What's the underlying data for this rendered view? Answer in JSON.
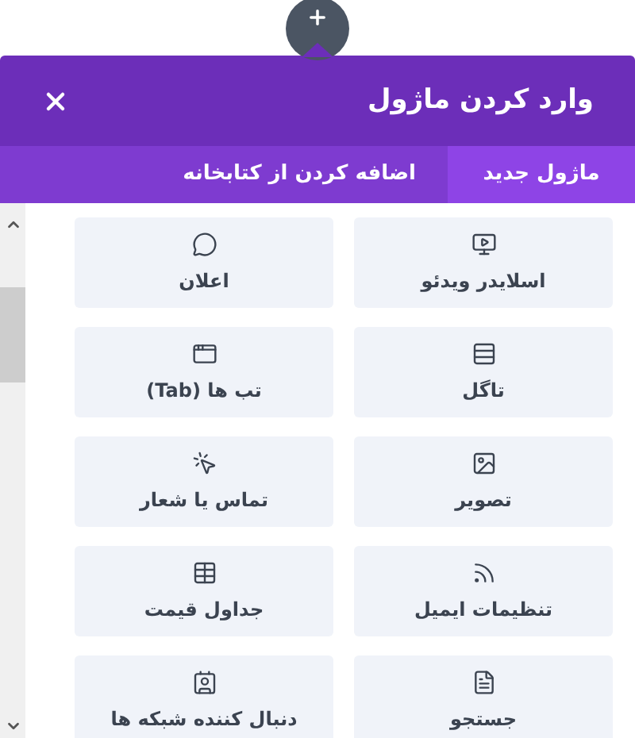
{
  "dialog": {
    "title": "وارد کردن ماژول"
  },
  "tabs": [
    {
      "label": "ماژول جدید",
      "selected": true
    },
    {
      "label": "اضافه کردن از کتابخانه",
      "selected": false
    }
  ],
  "modules": [
    {
      "label": "اسلایدر ویدئو"
    },
    {
      "label": "اعلان"
    },
    {
      "label": "تاگل"
    },
    {
      "label": "تب ها (Tab)"
    },
    {
      "label": "تصویر"
    },
    {
      "label": "تماس یا شعار"
    },
    {
      "label": "تنظیمات ایمیل"
    },
    {
      "label": "جداول قیمت"
    },
    {
      "label": "جستجو"
    },
    {
      "label": "دنبال کننده شبکه ها"
    }
  ]
}
